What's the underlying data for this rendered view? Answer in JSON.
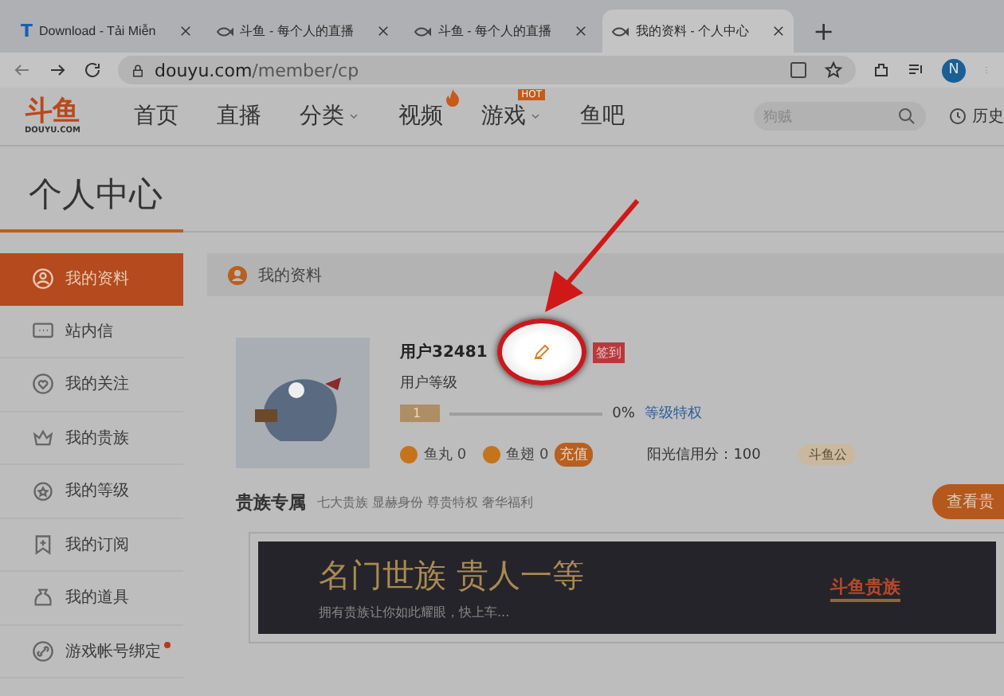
{
  "browser": {
    "tabs": [
      {
        "title": "Download - Tải Miễn",
        "kind": "letter",
        "icon_text": "T",
        "selected": false
      },
      {
        "title": "斗鱼 - 每个人的直播",
        "kind": "fish",
        "selected": false
      },
      {
        "title": "斗鱼 - 每个人的直播",
        "kind": "fish",
        "selected": false
      },
      {
        "title": "我的资料 - 个人中心",
        "kind": "fish",
        "selected": true
      }
    ],
    "new_tab": "+",
    "address": {
      "domain": "douyu.com",
      "path": "/member/cp"
    },
    "profile_initial": "N"
  },
  "site_header": {
    "logo_text": "斗鱼",
    "logo_subtext": "DOUYU.COM",
    "nav": [
      {
        "label": "首页",
        "kind": "plain"
      },
      {
        "label": "直播",
        "kind": "plain"
      },
      {
        "label": "分类",
        "kind": "dropdown"
      },
      {
        "label": "视频",
        "kind": "fire"
      },
      {
        "label": "游戏",
        "kind": "hot",
        "badge": "HOT"
      },
      {
        "label": "鱼吧",
        "kind": "plain"
      }
    ],
    "search": {
      "placeholder": "狗贼"
    },
    "history": "历史"
  },
  "page_title": "个人中心",
  "sidebar": {
    "items": [
      {
        "label": "我的资料",
        "selected": true,
        "dot": false
      },
      {
        "label": "站内信",
        "selected": false,
        "dot": false
      },
      {
        "label": "我的关注",
        "selected": false,
        "dot": false
      },
      {
        "label": "我的贵族",
        "selected": false,
        "dot": false
      },
      {
        "label": "我的等级",
        "selected": false,
        "dot": false
      },
      {
        "label": "我的订阅",
        "selected": false,
        "dot": false
      },
      {
        "label": "我的道具",
        "selected": false,
        "dot": false
      },
      {
        "label": "游戏帐号绑定",
        "selected": false,
        "dot": true
      }
    ]
  },
  "profile": {
    "section_title": "我的资料",
    "username": "用户32481",
    "checkin": "签到",
    "level_label": "用户等级",
    "level_badge": "1",
    "progress": {
      "level": 0
    },
    "percent": "0%",
    "privilege_link": "等级特权",
    "stats": [
      {
        "label": "鱼丸 0"
      },
      {
        "label": "鱼翅 0"
      }
    ],
    "recharge": "充值",
    "credit": "阳光信用分：100",
    "guild": "斗鱼公"
  },
  "noble": {
    "title": "贵族专属",
    "subtitle": "七大贵族 显赫身份 尊贵特权 奢华福利",
    "button": "查看贵",
    "banner": {
      "headline": "名门世族 贵人一等",
      "tagline": "拥有贵族让你如此耀眼，快上车...",
      "emblem": "斗鱼贵族"
    }
  }
}
